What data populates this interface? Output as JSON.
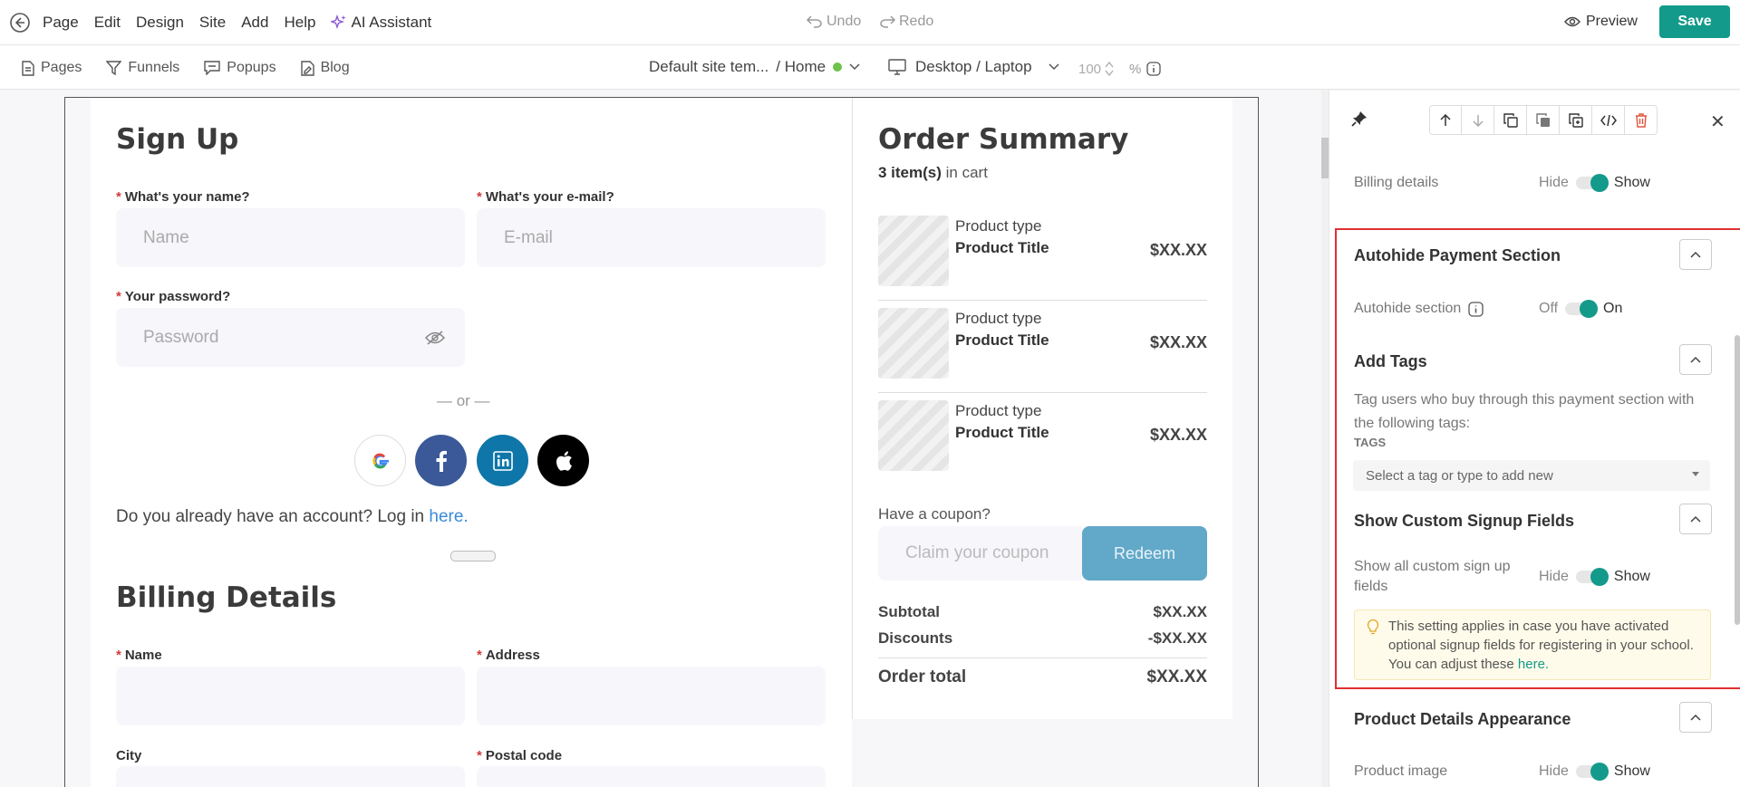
{
  "topbar": {
    "menu": [
      "Page",
      "Edit",
      "Design",
      "Site",
      "Add",
      "Help"
    ],
    "ai_label": "AI Assistant",
    "undo": "Undo",
    "redo": "Redo",
    "preview": "Preview",
    "save": "Save"
  },
  "subbar": {
    "nav": [
      "Pages",
      "Funnels",
      "Popups",
      "Blog"
    ],
    "site_template": "Default site tem...",
    "page": "/ Home",
    "device": "Desktop / Laptop",
    "zoom_value": "100",
    "zoom_unit": "%"
  },
  "signup": {
    "title": "Sign Up",
    "name_label": "What's your name?",
    "name_placeholder": "Name",
    "email_label": "What's your e-mail?",
    "email_placeholder": "E-mail",
    "password_label": "Your password?",
    "password_placeholder": "Password",
    "or": "— or —",
    "login_prefix": "Do you already have an account? Log in ",
    "login_link": "here."
  },
  "billing": {
    "title": "Billing Details",
    "name_label": "Name",
    "address_label": "Address",
    "city_label": "City",
    "postal_label": "Postal code"
  },
  "order": {
    "title": "Order Summary",
    "count_bold": "3 item(s)",
    "count_rest": " in cart",
    "products": [
      {
        "type": "Product type",
        "title": "Product Title",
        "price": "$XX.XX"
      },
      {
        "type": "Product type",
        "title": "Product Title",
        "price": "$XX.XX"
      },
      {
        "type": "Product type",
        "title": "Product Title",
        "price": "$XX.XX"
      }
    ],
    "coupon_label": "Have a coupon?",
    "coupon_placeholder": "Claim your coupon",
    "redeem": "Redeem",
    "subtotal_label": "Subtotal",
    "subtotal_value": "$XX.XX",
    "discounts_label": "Discounts",
    "discounts_value": "-$XX.XX",
    "total_label": "Order total",
    "total_value": "$XX.XX"
  },
  "panel": {
    "billing_details_label": "Billing details",
    "hide": "Hide",
    "show": "Show",
    "off": "Off",
    "on": "On",
    "autohide_title": "Autohide Payment Section",
    "autohide_label": "Autohide section",
    "tags_title": "Add Tags",
    "tags_desc": "Tag users who buy through this payment section with the following tags:",
    "tags_label": "TAGS",
    "tags_placeholder": "Select a tag or type to add new",
    "custom_title": "Show Custom Signup Fields",
    "custom_label": "Show all custom sign up fields",
    "note_text": "This setting applies in case you have activated optional signup fields for registering in your school. You can adjust these ",
    "note_link": "here.",
    "product_title": "Product Details Appearance",
    "product_image_label": "Product image"
  },
  "colors": {
    "accent": "#139a8a",
    "ai": "#8a4fd6",
    "highlight": "#e03030",
    "facebook": "#3b5998",
    "linkedin": "#0e76a8",
    "apple": "#000000"
  }
}
